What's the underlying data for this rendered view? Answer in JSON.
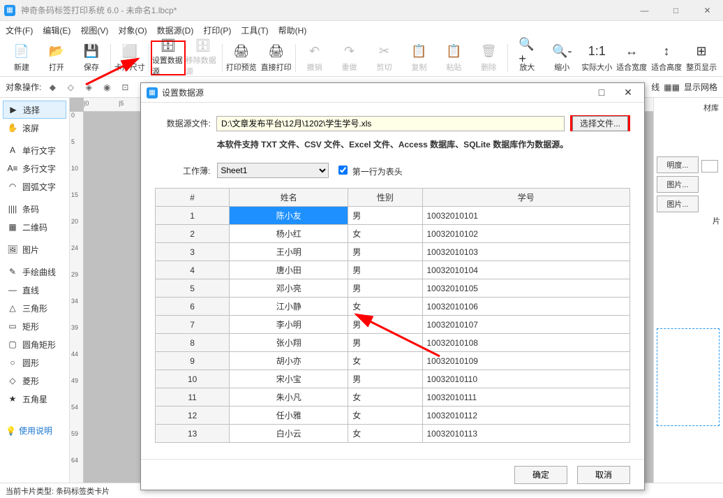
{
  "title": "神奇条码标签打印系统 6.0 - 未命名1.lbcp*",
  "menu": [
    "文件(F)",
    "编辑(E)",
    "视图(V)",
    "对象(O)",
    "数据源(D)",
    "打印(P)",
    "工具(T)",
    "帮助(H)"
  ],
  "toolbar": [
    "新建",
    "打开",
    "保存",
    "卡片尺寸",
    "设置数据源",
    "移除数据源",
    "打印预览",
    "直接打印",
    "撤销",
    "重做",
    "剪切",
    "复制",
    "粘贴",
    "删除",
    "放大",
    "缩小",
    "实际大小",
    "适合宽度",
    "适合高度",
    "整页显示"
  ],
  "objrow_label": "对象操作:",
  "objrow_right": [
    "线",
    "显示网格"
  ],
  "left_tools": [
    {
      "icon": "▶",
      "label": "选择",
      "sel": true
    },
    {
      "icon": "✋",
      "label": "滚屏"
    },
    {
      "icon": "A",
      "label": "单行文字"
    },
    {
      "icon": "A≡",
      "label": "多行文字"
    },
    {
      "icon": "◠",
      "label": "圆弧文字"
    },
    {
      "icon": "||||",
      "label": "条码"
    },
    {
      "icon": "▦",
      "label": "二维码"
    },
    {
      "icon": "🖼",
      "label": "图片"
    },
    {
      "icon": "✎",
      "label": "手绘曲线"
    },
    {
      "icon": "—",
      "label": "直线"
    },
    {
      "icon": "△",
      "label": "三角形"
    },
    {
      "icon": "▭",
      "label": "矩形"
    },
    {
      "icon": "▢",
      "label": "圆角矩形"
    },
    {
      "icon": "○",
      "label": "圆形"
    },
    {
      "icon": "◇",
      "label": "菱形"
    },
    {
      "icon": "★",
      "label": "五角星"
    }
  ],
  "help_label": "使用说明",
  "right_panel": {
    "b1": "明度...",
    "b2": "图片...",
    "b3": "图片...",
    "b4": "片",
    "lib": "材库"
  },
  "ruler_h": [
    "|0",
    "|5"
  ],
  "ruler_v": [
    "0",
    "5",
    "10",
    "15",
    "20",
    "24",
    "29",
    "34",
    "39",
    "44",
    "49",
    "54",
    "59",
    "64"
  ],
  "status": "当前卡片类型: 条码标签类卡片",
  "dialog": {
    "title": "设置数据源",
    "path_label": "数据源文件:",
    "path_value": "D:\\文章发布平台\\12月\\1202\\学生学号.xls",
    "browse": "选择文件...",
    "supports": "本软件支持 TXT 文件、CSV 文件、Excel 文件、Access 数据库、SQLite 数据库作为数据源。",
    "workbook_label": "工作薄:",
    "workbook": "Sheet1",
    "first_row_header": "第一行为表头",
    "headers": [
      "#",
      "姓名",
      "性别",
      "学号"
    ],
    "rows": [
      {
        "n": "1",
        "name": "陈小友",
        "sex": "男",
        "id": "10032010101",
        "sel": true
      },
      {
        "n": "2",
        "name": "杨小红",
        "sex": "女",
        "id": "10032010102"
      },
      {
        "n": "3",
        "name": "王小明",
        "sex": "男",
        "id": "10032010103"
      },
      {
        "n": "4",
        "name": "唐小田",
        "sex": "男",
        "id": "10032010104"
      },
      {
        "n": "5",
        "name": "邓小亮",
        "sex": "男",
        "id": "10032010105"
      },
      {
        "n": "6",
        "name": "江小静",
        "sex": "女",
        "id": "10032010106"
      },
      {
        "n": "7",
        "name": "李小明",
        "sex": "男",
        "id": "10032010107"
      },
      {
        "n": "8",
        "name": "张小翔",
        "sex": "男",
        "id": "10032010108"
      },
      {
        "n": "9",
        "name": "胡小亦",
        "sex": "女",
        "id": "10032010109"
      },
      {
        "n": "10",
        "name": "宋小宝",
        "sex": "男",
        "id": "10032010110"
      },
      {
        "n": "11",
        "name": "朱小凡",
        "sex": "女",
        "id": "10032010111"
      },
      {
        "n": "12",
        "name": "任小雅",
        "sex": "女",
        "id": "10032010112"
      },
      {
        "n": "13",
        "name": "白小云",
        "sex": "女",
        "id": "10032010113"
      }
    ],
    "ok": "确定",
    "cancel": "取消"
  }
}
